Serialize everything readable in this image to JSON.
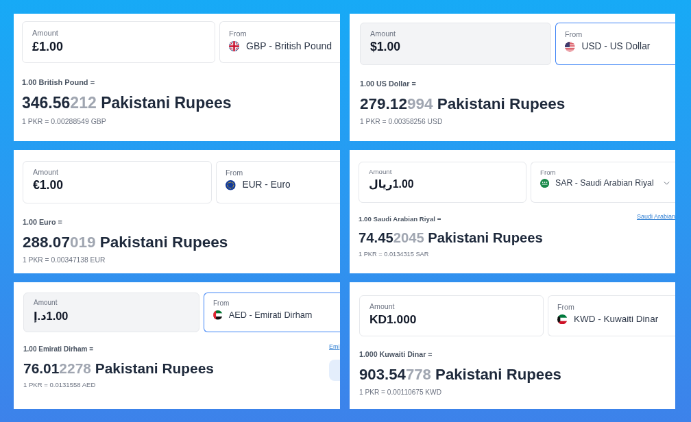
{
  "panels": [
    {
      "amount": {
        "label": "Amount",
        "value": "£1.00",
        "dimmed": false
      },
      "from": {
        "label": "From",
        "currency": "GBP - British Pound",
        "kind": "gb",
        "focused": false,
        "chevron": false
      },
      "base": "1.00 British Pound =",
      "result": {
        "value": "346.56",
        "extra_digits": "212",
        "unit": "Pakistani Rupees"
      },
      "inverse_rate": "1 PKR = 0.00288549 GBP",
      "side_button": false
    },
    {
      "amount": {
        "label": "Amount",
        "value": "$1.00",
        "dimmed": true
      },
      "from": {
        "label": "From",
        "currency": "USD - US Dollar",
        "kind": "us",
        "focused": true,
        "chevron": false
      },
      "base": "1.00 US Dollar =",
      "result": {
        "value": "279.12",
        "extra_digits": "994",
        "unit": "Pakistani Rupees"
      },
      "inverse_rate": "1 PKR = 0.00358256 USD",
      "side_button": false
    },
    {
      "amount": {
        "label": "Amount",
        "value": "€1.00",
        "dimmed": false
      },
      "from": {
        "label": "From",
        "currency": "EUR - Euro",
        "kind": "eu",
        "focused": false,
        "chevron": false
      },
      "base": "1.00 Euro =",
      "result": {
        "value": "288.07",
        "extra_digits": "019",
        "unit": "Pakistani Rupees"
      },
      "inverse_rate": "1 PKR = 0.00347138 EUR",
      "side_button": false
    },
    {
      "amount": {
        "label": "Amount",
        "value": "ريال‎1.00",
        "dimmed": false
      },
      "from": {
        "label": "From",
        "currency": "SAR - Saudi Arabian Riyal",
        "kind": "sa",
        "focused": false,
        "chevron": true
      },
      "base": "1.00 Saudi Arabian Riyal =",
      "link": "Saudi Arabian",
      "result": {
        "value": "74.45",
        "extra_digits": "2045",
        "unit": "Pakistani Rupees"
      },
      "inverse_rate": "1 PKR = 0.0134315 SAR",
      "side_button": false
    },
    {
      "amount": {
        "label": "Amount",
        "value": "د.إ‎1.00",
        "dimmed": true
      },
      "from": {
        "label": "From",
        "currency": "AED - Emirati Dirham",
        "kind": "ae",
        "focused": true,
        "chevron": false
      },
      "base": "1.00 Emirati Dirham =",
      "link": "Emi",
      "result": {
        "value": "76.01",
        "extra_digits": "2278",
        "unit": "Pakistani Rupees"
      },
      "inverse_rate": "1 PKR = 0.0131558 AED",
      "side_button": true
    },
    {
      "amount": {
        "label": "Amount",
        "value": "KD1.000",
        "dimmed": false
      },
      "from": {
        "label": "From",
        "currency": "KWD - Kuwaiti Dinar",
        "kind": "kw",
        "focused": false,
        "chevron": false
      },
      "base": "1.000 Kuwaiti Dinar =",
      "result": {
        "value": "903.54",
        "extra_digits": "778",
        "unit": "Pakistani Rupees"
      },
      "inverse_rate": "1 PKR = 0.00110675 KWD",
      "side_button": false
    }
  ]
}
